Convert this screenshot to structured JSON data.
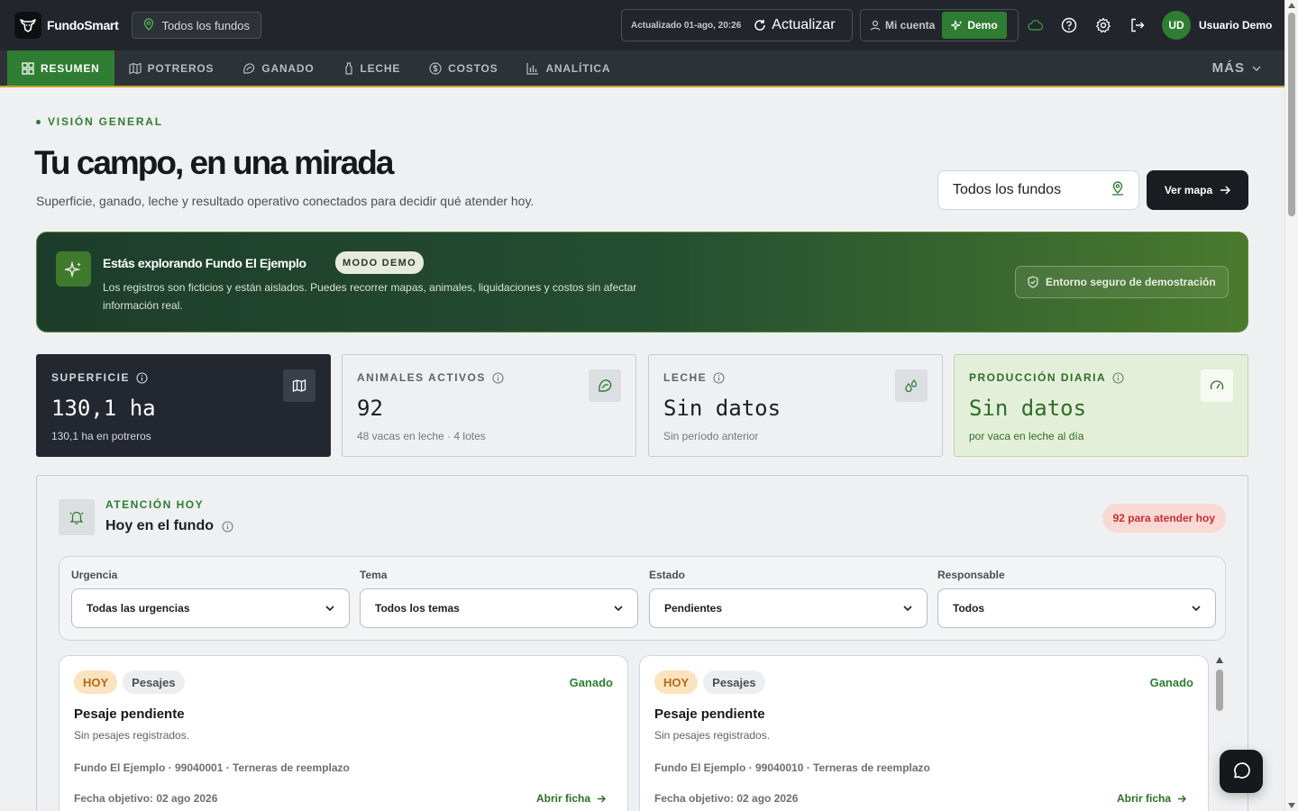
{
  "app": {
    "name": "FundoSmart",
    "fund_chip": "Todos los fundos"
  },
  "topbar": {
    "updated": "Actualizado 01-ago, 20:26",
    "refresh_label": "Actualizar",
    "account_label": "Mi cuenta",
    "demo_label": "Demo",
    "user_initials": "UD",
    "user_name": "Usuario Demo"
  },
  "nav": {
    "items": [
      {
        "label": "RESUMEN",
        "icon": "grid-icon",
        "active": true
      },
      {
        "label": "POTREROS",
        "icon": "map-icon",
        "active": false
      },
      {
        "label": "GANADO",
        "icon": "cow-icon",
        "active": false
      },
      {
        "label": "LECHE",
        "icon": "bottle-icon",
        "active": false
      },
      {
        "label": "COSTOS",
        "icon": "dollar-icon",
        "active": false
      },
      {
        "label": "ANALÍTICA",
        "icon": "bar-chart-icon",
        "active": false
      }
    ],
    "more_label": "MÁS"
  },
  "header": {
    "eyebrow": "VISIÓN GENERAL",
    "title": "Tu campo, en una mirada",
    "subtitle": "Superficie, ganado, leche y resultado operativo conectados para decidir qué atender hoy.",
    "fund_select": "Todos los fundos",
    "map_button": "Ver mapa"
  },
  "banner": {
    "title": "Estás explorando Fundo El Ejemplo",
    "badge": "MODO DEMO",
    "text": "Los registros son ficticios y están aislados. Puedes recorrer mapas, animales, liquidaciones y costos sin afectar información real.",
    "env_label": "Entorno seguro de demostración"
  },
  "stats": [
    {
      "label": "SUPERFICIE",
      "value": "130,1 ha",
      "sub": "130,1 ha en potreros",
      "icon": "map-icon"
    },
    {
      "label": "ANIMALES ACTIVOS",
      "value": "92",
      "sub": "48 vacas en leche · 4 lotes",
      "icon": "cow-icon"
    },
    {
      "label": "LECHE",
      "value": "Sin datos",
      "sub": "Sin período anterior",
      "icon": "droplets-icon"
    },
    {
      "label": "PRODUCCIÓN DIARIA",
      "value": "Sin datos",
      "sub": "por vaca en leche al día",
      "icon": "gauge-icon"
    }
  ],
  "attention": {
    "eyebrow": "ATENCIÓN HOY",
    "title": "Hoy en el fundo",
    "badge": "92 para atender hoy",
    "filters": [
      {
        "label": "Urgencia",
        "value": "Todas las urgencias"
      },
      {
        "label": "Tema",
        "value": "Todos los temas"
      },
      {
        "label": "Estado",
        "value": "Pendientes"
      },
      {
        "label": "Responsable",
        "value": "Todos"
      }
    ],
    "tasks": [
      {
        "tag_when": "HOY",
        "tag_cat": "Pesajes",
        "area": "Ganado",
        "title": "Pesaje pendiente",
        "desc": "Sin pesajes registrados.",
        "meta": "Fundo El Ejemplo · 99040001 · Terneras de reemplazo",
        "date": "Fecha objetivo: 02 ago 2026",
        "link": "Abrir ficha"
      },
      {
        "tag_when": "HOY",
        "tag_cat": "Pesajes",
        "area": "Ganado",
        "title": "Pesaje pendiente",
        "desc": "Sin pesajes registrados.",
        "meta": "Fundo El Ejemplo · 99040010 · Terneras de reemplazo",
        "date": "Fecha objetivo: 02 ago 2026",
        "link": "Abrir ficha"
      }
    ]
  },
  "colors": {
    "accent": "#2f7d32",
    "topbar": "#22262c",
    "nav": "#2d3238",
    "nav_underline": "#c9a227",
    "alert": "#c4312b"
  }
}
